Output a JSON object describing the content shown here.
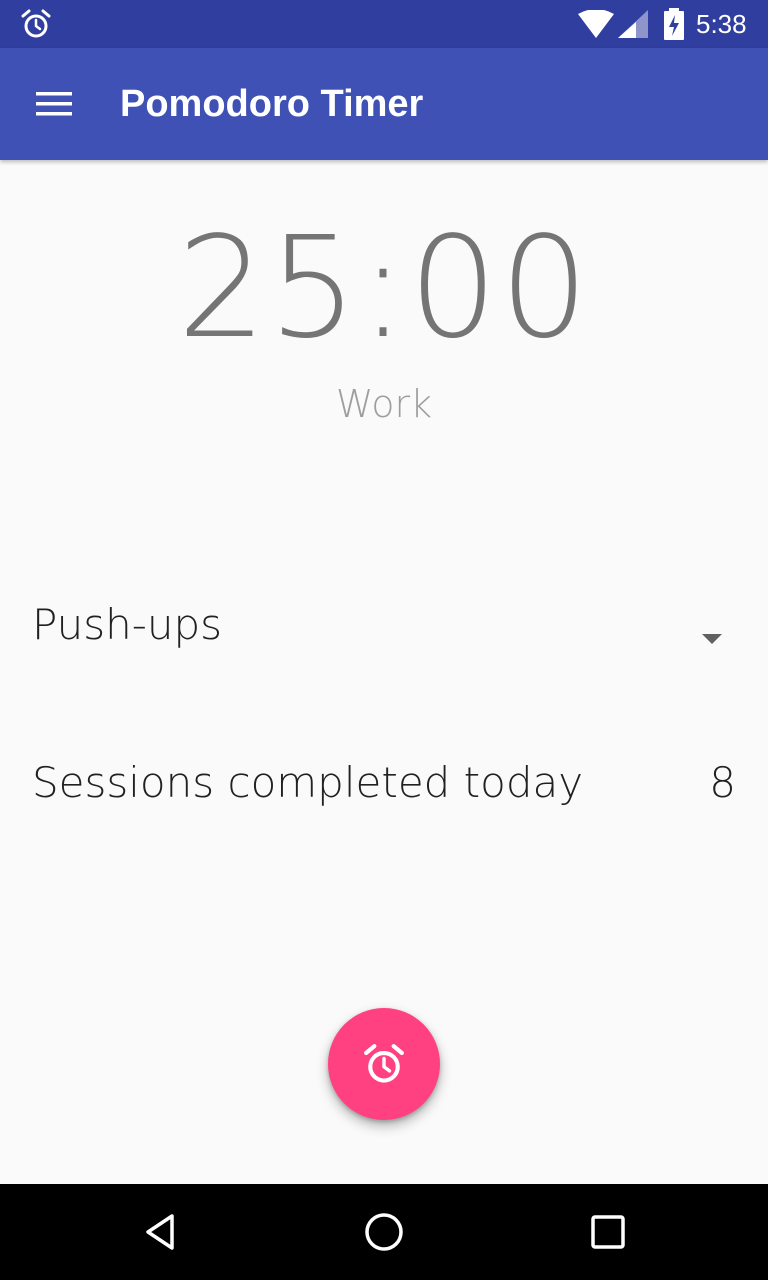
{
  "status_bar": {
    "time": "5:38",
    "icons": [
      "alarm-icon",
      "wifi-icon",
      "cell-signal-icon",
      "battery-charging-icon"
    ]
  },
  "toolbar": {
    "title": "Pomodoro Timer",
    "menu_icon": "menu-icon"
  },
  "timer": {
    "time": "25:00",
    "phase": "Work"
  },
  "exercise_spinner": {
    "selected": "Push-ups",
    "icon": "dropdown-arrow-icon"
  },
  "sessions": {
    "label": "Sessions completed today",
    "count": "8"
  },
  "fab": {
    "icon": "alarm-icon"
  },
  "navigation_bar": {
    "icons": [
      "back-icon",
      "home-icon",
      "recents-icon"
    ]
  },
  "colors": {
    "status_bar": "#303f9f",
    "toolbar": "#3f51b5",
    "accent": "#ff4081",
    "background": "#fafafa",
    "timer_text": "#757575",
    "nav_bar": "#000000"
  }
}
